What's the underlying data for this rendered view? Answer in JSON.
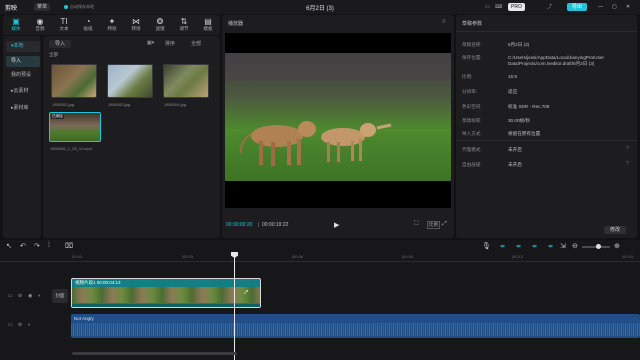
{
  "app": {
    "logo": "剪映",
    "menu_label": "菜单",
    "status": "自动保存本地",
    "title": "6月2日 (3)",
    "pro_label": "PRO",
    "export_label": "导出"
  },
  "toolbar": {
    "items": [
      {
        "label": "媒体",
        "icon": "media-icon"
      },
      {
        "label": "音频",
        "icon": "audio-icon"
      },
      {
        "label": "文本",
        "icon": "text-icon"
      },
      {
        "label": "贴纸",
        "icon": "sticker-icon"
      },
      {
        "label": "特效",
        "icon": "effects-icon"
      },
      {
        "label": "转场",
        "icon": "transition-icon"
      },
      {
        "label": "滤镜",
        "icon": "filter-icon"
      },
      {
        "label": "调节",
        "icon": "adjust-icon"
      },
      {
        "label": "模板",
        "icon": "template-icon"
      }
    ]
  },
  "sidebar": {
    "items": [
      "▾本地",
      "导入",
      "我的预设",
      "▸云素材",
      "▸素材库"
    ]
  },
  "media": {
    "import_label": "导入",
    "sort_label": "排序",
    "all_label": "全部",
    "section": "全部",
    "files": [
      {
        "name": "1555262.jpg"
      },
      {
        "name": "1555263.jpg"
      },
      {
        "name": "1555264.jpg"
      },
      {
        "name": "1555265_1_25_11.mp4"
      }
    ],
    "clip_badge": "已添加"
  },
  "player": {
    "title": "播放器",
    "current_time": "00:00:00:20",
    "total_time": "00:00:19:22",
    "ratio_label": "比例"
  },
  "props": {
    "title": "草稿参数",
    "rows": [
      {
        "label": "草稿名称:",
        "value": "6月2日 (3)"
      },
      {
        "label": "保存位置:",
        "value": "C:/Users/jessi/AppData/Local/JianyingPro/User Data/Projects/com.lveditor.draft/6月2日 (3)"
      },
      {
        "label": "比例:",
        "value": "16:9"
      },
      {
        "label": "分辨率:",
        "value": "适应"
      },
      {
        "label": "色彩空间:",
        "value": "标准 SDR - Rec.709"
      },
      {
        "label": "草稿帧率:",
        "value": "30.00帧/秒"
      },
      {
        "label": "导入方式:",
        "value": "保留在原有位置"
      },
      {
        "label": "代理模式:",
        "value": "未开启"
      },
      {
        "label": "自由层级:",
        "value": "未开启"
      }
    ],
    "edit_button": "修改"
  },
  "timeline": {
    "ruler": [
      "00:00",
      "|00:03",
      "|00:06",
      "|00:09",
      "|00:12",
      "|00:15"
    ],
    "video_clip_label": "视频片段1  00:00:04:13",
    "cover_label": "封面",
    "audio_clip_label": "Not Angry"
  },
  "colors": {
    "accent": "#20c4d8",
    "video_track": "#127e86",
    "audio_track": "#1f4f86"
  }
}
